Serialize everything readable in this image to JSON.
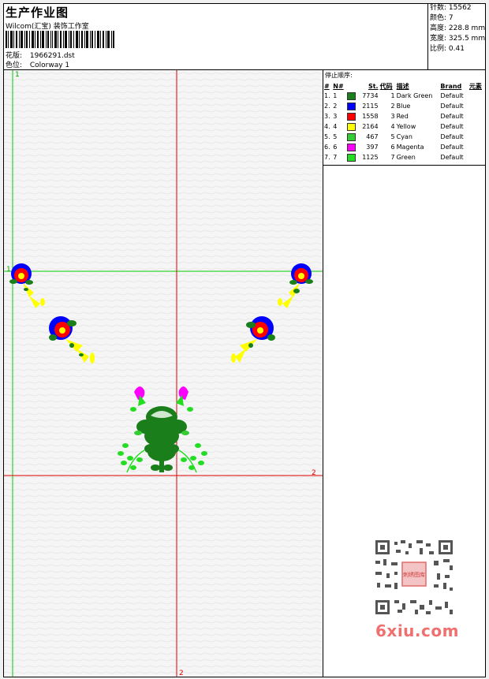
{
  "header": {
    "title": "生产作业图",
    "company": "Wilcom(汇宝) 装饰工作室",
    "design_label": "花版:",
    "design_value": "1966291.dst",
    "color_label": "色位:",
    "color_value": "Colorway 1"
  },
  "stats": {
    "stitches_label": "针数:",
    "stitches_value": "15562",
    "colors_label": "颜色:",
    "colors_value": "7",
    "height_label": "高度:",
    "height_value": "228.8 mm",
    "width_label": "宽度:",
    "width_value": "325.5 mm",
    "scale_label": "比例:",
    "scale_value": "0.41"
  },
  "stop_sequence": {
    "title": "停止顺序:",
    "columns": [
      "#",
      "N#",
      "St.",
      "代码",
      "描述",
      "Brand",
      "元素"
    ],
    "rows": [
      {
        "idx": "1.",
        "n": "1",
        "color": "#1a7f1a",
        "st": "7734",
        "code": "1",
        "desc": "Dark Green",
        "brand": "Default"
      },
      {
        "idx": "2.",
        "n": "2",
        "color": "#0000ff",
        "st": "2115",
        "code": "2",
        "desc": "Blue",
        "brand": "Default"
      },
      {
        "idx": "3.",
        "n": "3",
        "color": "#ff0000",
        "st": "1558",
        "code": "3",
        "desc": "Red",
        "brand": "Default"
      },
      {
        "idx": "4.",
        "n": "4",
        "color": "#ffff00",
        "st": "2164",
        "code": "4",
        "desc": "Yellow",
        "brand": "Default"
      },
      {
        "idx": "5.",
        "n": "5",
        "color": "#33cc33",
        "st": "467",
        "code": "5",
        "desc": "Cyan",
        "brand": "Default"
      },
      {
        "idx": "6.",
        "n": "6",
        "color": "#ff00ff",
        "st": "397",
        "code": "6",
        "desc": "Magenta",
        "brand": "Default"
      },
      {
        "idx": "7.",
        "n": "7",
        "color": "#22dd22",
        "st": "1125",
        "code": "7",
        "desc": "Green",
        "brand": "Default"
      }
    ]
  },
  "guides": {
    "label_1": "1",
    "label_2": "2"
  },
  "watermark": {
    "qr_caption": "刺绣图库",
    "brand": "6xiu.com"
  },
  "colors": {
    "guide_green": "#00cc00",
    "guide_red": "#e00000",
    "brand_pink": "#f07070"
  }
}
